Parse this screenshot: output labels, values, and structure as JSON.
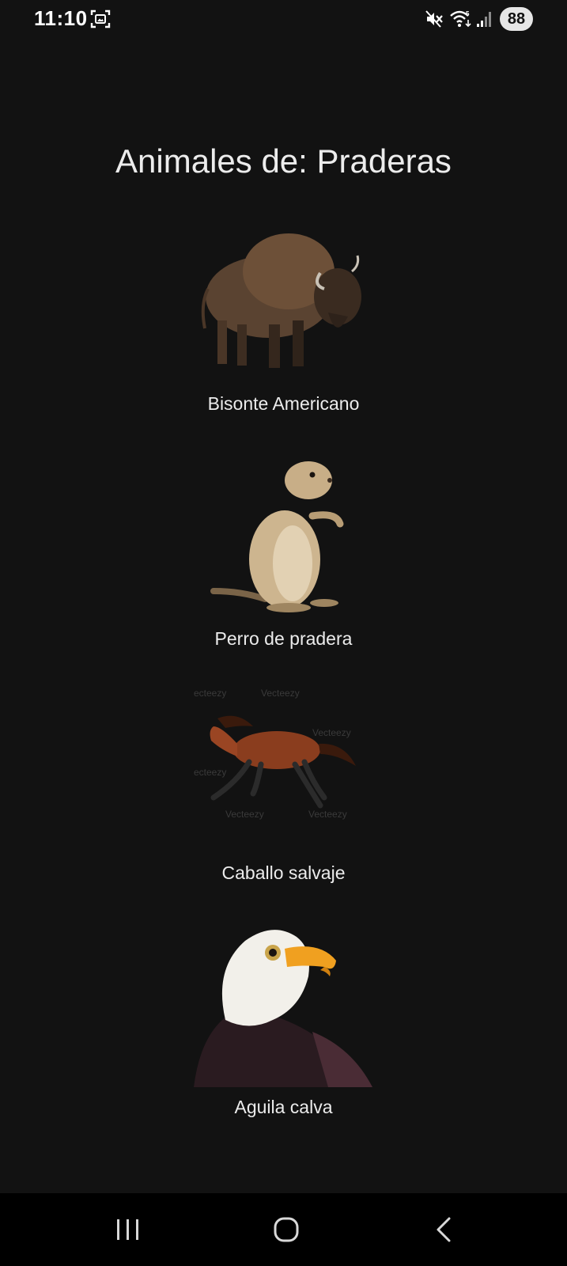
{
  "status_bar": {
    "time": "11:10",
    "battery": "88",
    "icons": [
      "screen-record-icon",
      "mute-icon",
      "wifi-icon",
      "signal-icon"
    ]
  },
  "page": {
    "title": "Animales de: Praderas"
  },
  "animals": [
    {
      "name": "Bisonte Americano",
      "icon": "bison-image"
    },
    {
      "name": "Perro de pradera",
      "icon": "prairie-dog-image"
    },
    {
      "name": "Caballo salvaje",
      "icon": "wild-horse-image"
    },
    {
      "name": "Aguila calva",
      "icon": "bald-eagle-image"
    }
  ],
  "nav_bar": {
    "icons": [
      "recent-apps-icon",
      "home-icon",
      "back-icon"
    ]
  },
  "colors": {
    "background": "#121212",
    "text": "#ececec",
    "nav_background": "#000000"
  }
}
